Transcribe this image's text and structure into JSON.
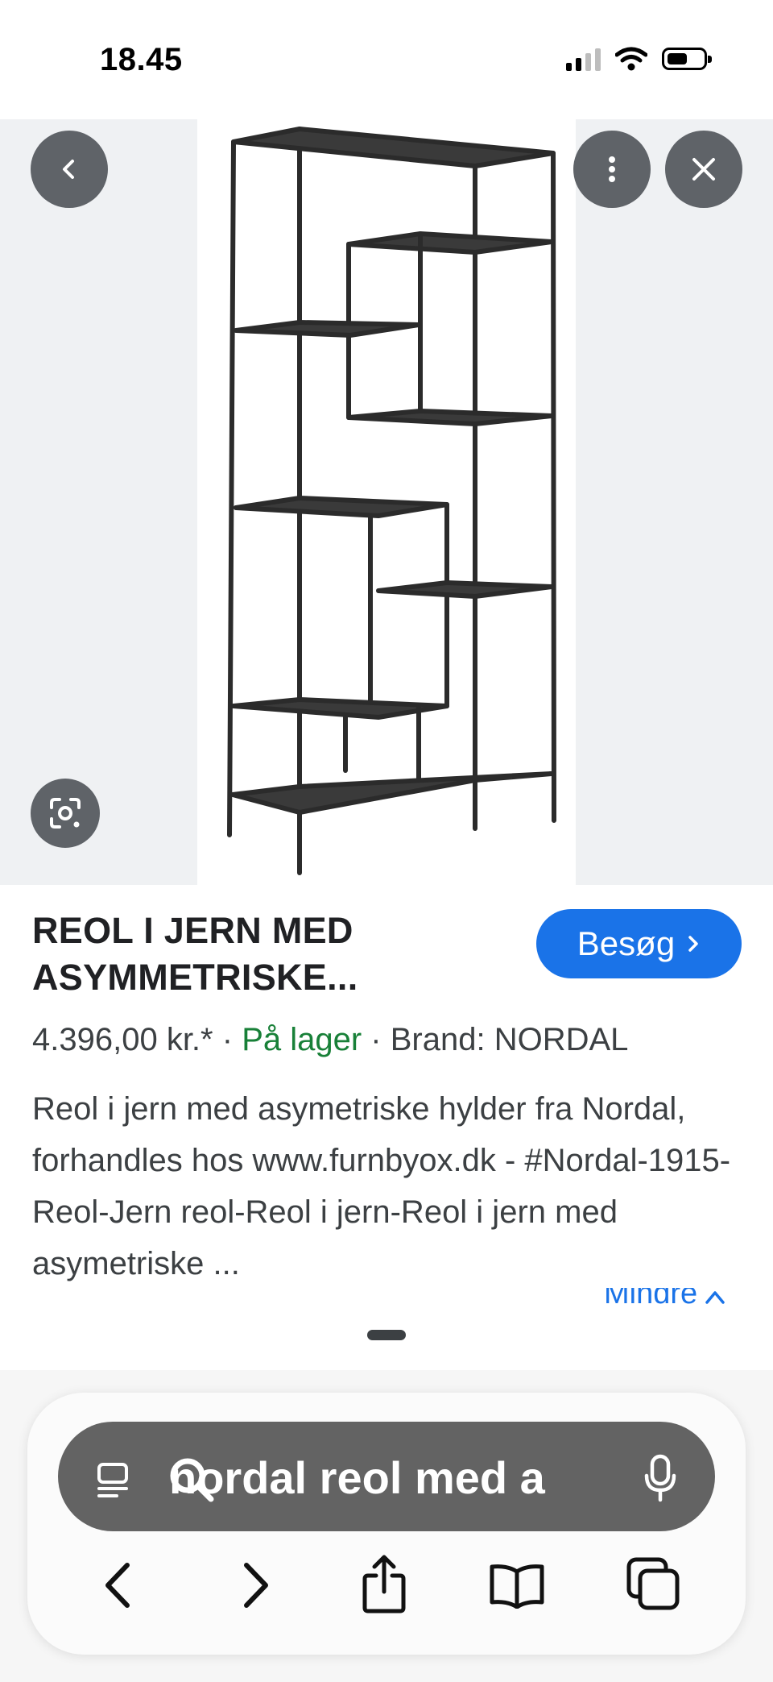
{
  "status_bar": {
    "time": "18.45",
    "icons": [
      "cellular-signal-icon",
      "wifi-icon",
      "battery-icon"
    ]
  },
  "image_viewer": {
    "icons": [
      "back-arrow-icon",
      "more-vert-icon",
      "close-icon",
      "google-lens-icon"
    ],
    "image_subject": "shelf-product-image"
  },
  "result": {
    "title": "REOL I JERN MED ASYMMETRISKE...",
    "visit_button_label": "Besøg",
    "price": "4.396,00 kr.*",
    "separator": "·",
    "stock": "På lager",
    "brand": "Brand: NORDAL",
    "description": "Reol i jern med asymetriske hylder fra Nordal, forhandles hos www.furnbyox.dk - #Nordal-1915-Reol-Jern reol-Reol i jern-Reol i jern med asymetriske ...",
    "less_label": "Mindre",
    "colors": {
      "visit_button": "#1a73e8",
      "stock": "#188038",
      "link": "#1a73e8"
    }
  },
  "browser_toolbar": {
    "search_query": "nordal reol med a",
    "icons": [
      "reader-icon",
      "search-icon",
      "microphone-icon",
      "back-icon",
      "forward-icon",
      "share-icon",
      "bookmarks-icon",
      "tabs-icon"
    ]
  }
}
